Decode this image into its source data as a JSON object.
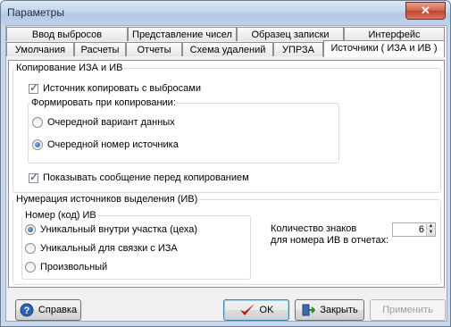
{
  "window": {
    "title": "Параметры",
    "close_glyph": "✕"
  },
  "tabs_row1": [
    "Ввод выбросов",
    "Представление чисел",
    "Образец записки",
    "Интерфейс"
  ],
  "tabs_row2": [
    "Умолчания",
    "Расчеты",
    "Отчеты",
    "Схема удалений",
    "УПРЗА",
    "Источники ( ИЗА и ИВ )"
  ],
  "active_tab": "Источники ( ИЗА и ИВ )",
  "copy_group": {
    "title": "Копирование ИЗА и ИВ",
    "copy_with_emissions": {
      "label": "Источник копировать с  выбросами",
      "checked": true
    },
    "form_group": {
      "title": "Формировать при копировании:",
      "options": [
        {
          "label": "Очередной вариант данных",
          "checked": false
        },
        {
          "label": "Очередной номер источника",
          "checked": true
        }
      ]
    },
    "show_message": {
      "label": "Показывать сообщение перед копированием",
      "checked": true
    }
  },
  "numbering_group": {
    "title": "Нумерация источников выделения (ИВ)",
    "code_group": {
      "title": "Номер (код)  ИВ",
      "options": [
        {
          "label": "Уникальный внутри участка (цеха)",
          "checked": true
        },
        {
          "label": "Уникальный для связки с ИЗА",
          "checked": false
        },
        {
          "label": "Произвольный",
          "checked": false
        }
      ]
    },
    "digits_label_line1": "Количество знаков",
    "digits_label_line2": "для номера ИВ в отчетах:",
    "digits_value": "6"
  },
  "buttons": {
    "help": "Справка",
    "ok": "OK",
    "close": "Закрыть",
    "apply": "Применить"
  },
  "icons": {
    "help": "help-icon",
    "ok": "checkmark-icon",
    "close": "exit-door-icon",
    "close_window": "close-icon"
  },
  "colors": {
    "titlebar": "#c3d4eb",
    "close_button": "#c94b34",
    "checkmark": "#c11818"
  }
}
